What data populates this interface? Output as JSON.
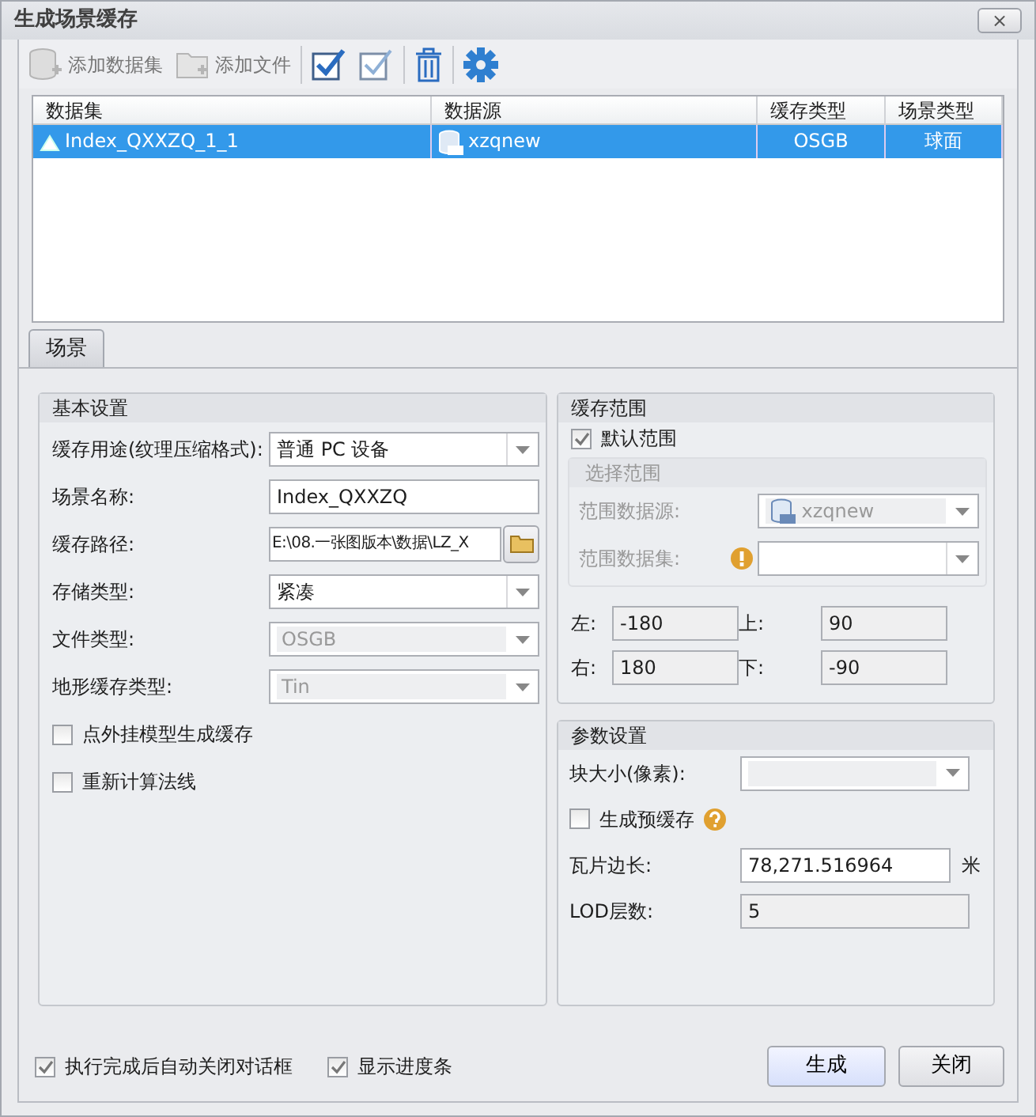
{
  "window": {
    "title": "生成场景缓存",
    "close": "×"
  },
  "toolbar": {
    "text_buttons": [
      {
        "label": "添加数据集",
        "disabled": true
      },
      {
        "label": "添加文件",
        "disabled": true
      }
    ],
    "icon_buttons": [
      {
        "disabled": false
      },
      {
        "disabled": true
      },
      {
        "disabled": false
      },
      {
        "disabled": false
      }
    ]
  },
  "table": {
    "columns": [
      "数据集",
      "数据源",
      "缓存类型",
      "场景类型"
    ],
    "rows": [
      {
        "cells": [
          "Index_QXXZQ_1_1",
          "xzqnew",
          "OSGB",
          "球面"
        ],
        "selected": true
      }
    ]
  },
  "tabs": [
    {
      "label": "场景",
      "selected": true
    }
  ],
  "basic": {
    "title": "基本设置",
    "fields": [
      {
        "kind": "combo",
        "label": "缓存用途(纹理压缩格式):",
        "value": "普通 PC 设备",
        "disabled": false
      },
      {
        "kind": "text",
        "label": "场景名称:",
        "value": "Index_QXXZQ",
        "disabled": false
      },
      {
        "kind": "path",
        "label": "缓存路径:",
        "value": "E:\\08.一张图版本\\数据\\LZ_X",
        "disabled": false
      },
      {
        "kind": "combo",
        "label": "存储类型:",
        "value": "紧凑",
        "disabled": false
      },
      {
        "kind": "combo",
        "label": "文件类型:",
        "value": "OSGB",
        "disabled": true
      },
      {
        "kind": "combo",
        "label": "地形缓存类型:",
        "value": "Tin",
        "disabled": true
      }
    ],
    "checkboxes": [
      {
        "label": "点外挂模型生成缓存",
        "checked": false
      },
      {
        "label": "重新计算法线",
        "checked": false
      }
    ]
  },
  "range": {
    "title": "缓存范围",
    "default_range": {
      "label": "默认范围",
      "checked": true
    },
    "select_range": {
      "title": "选择范围",
      "disabled": true,
      "fields": [
        {
          "label": "范围数据源:",
          "value": "xzqnew",
          "warning": false
        },
        {
          "label": "范围数据集:",
          "warning": true
        }
      ]
    },
    "bounds": [
      {
        "label": "左:",
        "value": "-180"
      },
      {
        "label": "上:",
        "value": "90"
      },
      {
        "label": "右:",
        "value": "180"
      },
      {
        "label": "下:",
        "value": "-90"
      }
    ]
  },
  "params": {
    "title": "参数设置",
    "rows": [
      {
        "kind": "combo",
        "label": "块大小(像素):",
        "disabled": true
      },
      {
        "kind": "checkbox",
        "label": "生成预缓存",
        "checked": false,
        "help": true
      },
      {
        "kind": "text",
        "label": "瓦片边长:",
        "value": "78,271.516964",
        "unit": "米",
        "disabled": false
      },
      {
        "kind": "text",
        "label": "LOD层数:",
        "value": "5",
        "disabled": true
      }
    ]
  },
  "footer": {
    "checkboxes": [
      {
        "label": "执行完成后自动关闭对话框",
        "checked": true
      },
      {
        "label": "显示进度条",
        "checked": true
      }
    ],
    "buttons": [
      {
        "label": "生成",
        "default": true
      },
      {
        "label": "关闭",
        "default": false
      }
    ]
  }
}
